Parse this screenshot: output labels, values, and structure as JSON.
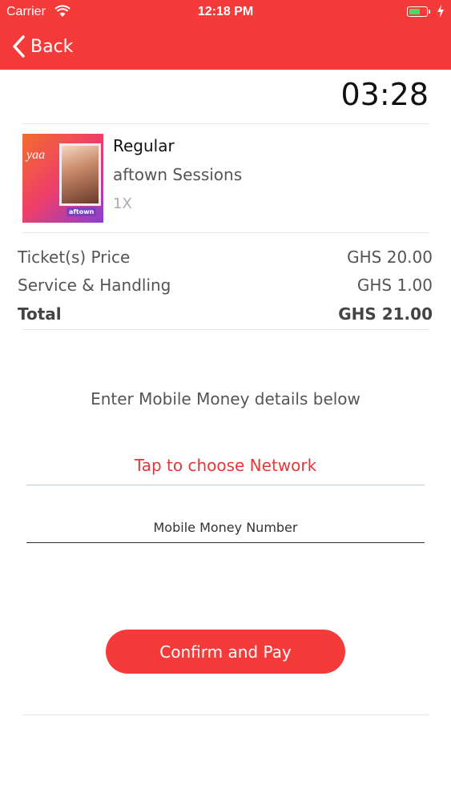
{
  "status_bar": {
    "carrier": "Carrier",
    "time": "12:18 PM"
  },
  "nav": {
    "back_label": "Back"
  },
  "timer": "03:28",
  "ticket": {
    "poster_text": "yaa",
    "poster_tag": "aftown",
    "type": "Regular",
    "event": "aftown Sessions",
    "quantity": "1X"
  },
  "pricing": {
    "rows": [
      {
        "label": "Ticket(s) Price",
        "value": "GHS 20.00"
      },
      {
        "label": "Service & Handling",
        "value": "GHS 1.00"
      }
    ],
    "total_label": "Total",
    "total_value": "GHS 21.00"
  },
  "payment": {
    "instruction": "Enter Mobile Money details below",
    "network_placeholder": "Tap to choose Network",
    "number_placeholder": "Mobile Money Number",
    "confirm_label": "Confirm and Pay"
  },
  "colors": {
    "brand": "#f53a3a",
    "battery": "#4cd964",
    "network_text": "#e53838"
  }
}
